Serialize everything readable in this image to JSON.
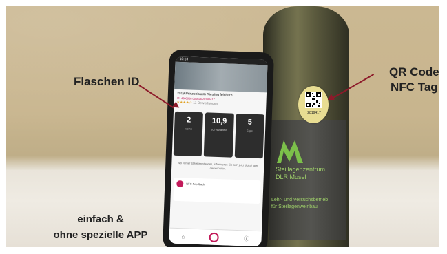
{
  "annotations": {
    "bottle_id": "Flaschen ID",
    "qr_line1": "QR Code",
    "qr_line2": "NFC Tag",
    "app_line1": "einfach &",
    "app_line2": "ohne spezielle APP"
  },
  "bottle_label": {
    "line1": "Steillagenzentrum",
    "line2": "DLR Mosel",
    "line3": "Lehr- und Versuchsbetrieb",
    "line4": "für Steillagenweinbau",
    "qr_number": "2819417"
  },
  "phone": {
    "status_time": "10:13",
    "wine_title": "2019 Prinzenbaum Riesling feinherb",
    "wine_id": "ID: 4000000.000026.20190417",
    "rating_text": "11 Bewertungen",
    "cards": [
      {
        "big": "2",
        "label": "weine"
      },
      {
        "big": "10,9",
        "label": "Vol % Alkohol"
      },
      {
        "big": "5",
        "label": "Expe"
      }
    ],
    "info_text": "Wo vorher Etiketten standen, informieren Sie sich jetzt digital über diesen Wein.",
    "feedback_title": "NFC Feedback",
    "colors": {
      "accent": "#c21a5a"
    }
  },
  "colors": {
    "arrow": "#8d1a2a",
    "bottle_text": "#9fd06a"
  }
}
